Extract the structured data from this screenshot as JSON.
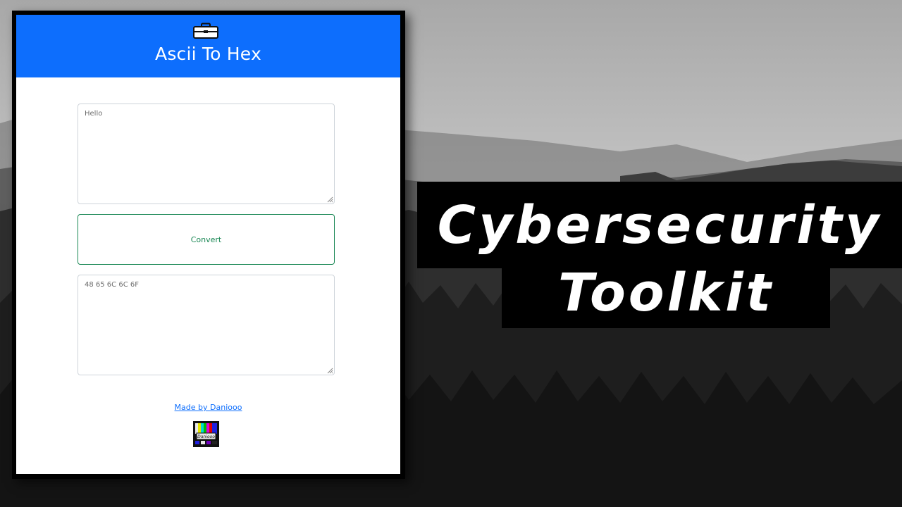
{
  "app": {
    "title": "Ascii To Hex",
    "header_icon": "toolbox-icon",
    "input_text": "Hello",
    "convert_label": "Convert",
    "output_text": "48 65 6C 6C 6F",
    "credit_link": "Made by Daniooo",
    "logo_text": "Daniooo",
    "colors": {
      "header": "#0d6efd",
      "button": "#198754",
      "link": "#0d6efd"
    }
  },
  "banner": {
    "line1": "Cybersecurity",
    "line2": "Toolkit"
  }
}
